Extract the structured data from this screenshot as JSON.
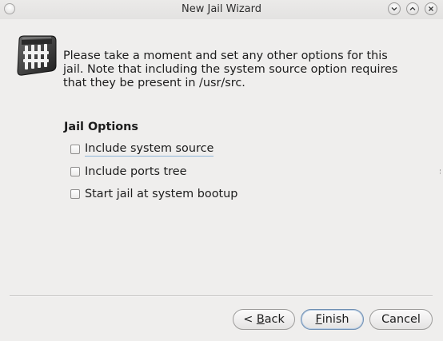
{
  "window": {
    "title": "New Jail Wizard"
  },
  "logo": {
    "icon": "jail-bars-icon"
  },
  "intro": {
    "lines": [
      "Please take a moment and set any other options for this",
      "jail. Note that including the system source option requires",
      "that they be present in /usr/src."
    ]
  },
  "options": {
    "title": "Jail Options",
    "items": [
      {
        "label": "Include system source",
        "checked": false
      },
      {
        "label": "Include ports tree",
        "checked": false
      },
      {
        "label": "Start jail at system bootup",
        "checked": false
      }
    ]
  },
  "buttons": {
    "back": {
      "prefix": "< ",
      "mnemonic": "B",
      "rest": "ack"
    },
    "finish": {
      "mnemonic": "F",
      "rest": "inish"
    },
    "cancel": "Cancel"
  },
  "colors": {
    "window_bg": "#efeeed",
    "focus_underline": "#8fb5d8",
    "default_button_border": "#6f8fb3"
  }
}
